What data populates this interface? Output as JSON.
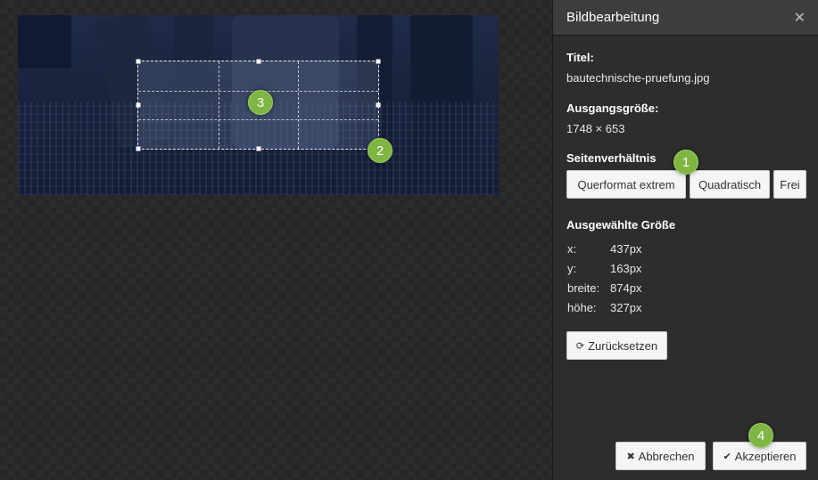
{
  "image": {
    "crop_markers": [
      "3",
      "2"
    ]
  },
  "panel": {
    "title": "Bildbearbeitung",
    "close_glyph": "✕",
    "title_label": "Titel:",
    "filename": "bautechnische-pruefung.jpg",
    "original_size_label": "Ausgangsgröße:",
    "original_size": "1748 × 653",
    "aspect_label": "Seitenverhältnis",
    "aspect_options": [
      "Querformat extrem",
      "Quadratisch",
      "Frei"
    ],
    "aspect_marker": "1",
    "selected_size_label": "Ausgewählte Größe",
    "stats": [
      {
        "key": "x:",
        "value": "437px"
      },
      {
        "key": "y:",
        "value": "163px"
      },
      {
        "key": "breite:",
        "value": "874px"
      },
      {
        "key": "höhe:",
        "value": "327px"
      }
    ],
    "reset_label": "Zurücksetzen",
    "reset_icon": "refresh-icon",
    "cancel_label": "Abbrechen",
    "cancel_icon": "times-icon",
    "accept_label": "Akzeptieren",
    "accept_icon": "check-icon",
    "accept_marker": "4"
  },
  "colors": {
    "marker_green": "#7fb543",
    "panel_bg": "#2d2d2d",
    "header_bg": "#3d3d3d"
  }
}
